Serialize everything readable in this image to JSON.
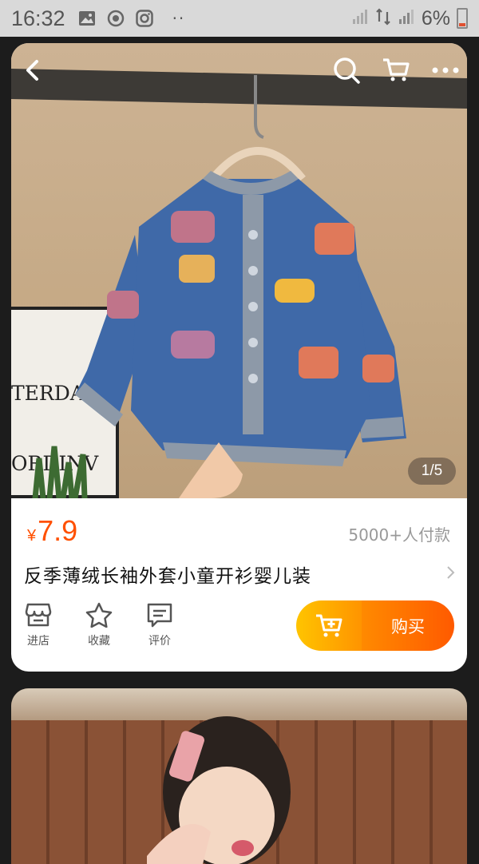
{
  "status_bar": {
    "time": "16:32",
    "icons_left": [
      "gallery-icon",
      "sync-icon",
      "instagram-icon"
    ],
    "dots": "··",
    "battery_text": "6%"
  },
  "product": {
    "pager": "1/5",
    "currency": "¥",
    "price": "7.9",
    "sold": "5000+人付款",
    "title": "反季薄绒长袖外套小童开衫婴儿装",
    "poster_lines": [
      "TERDAY",
      "ORDINV"
    ]
  },
  "actions": [
    {
      "icon": "store-icon",
      "label": "进店"
    },
    {
      "icon": "star-icon",
      "label": "收藏"
    },
    {
      "icon": "review-icon",
      "label": "评价"
    }
  ],
  "buy_label": "购买",
  "colors": {
    "accent": "#ff5000",
    "cart_gradient": [
      "#ffc400",
      "#ff9400"
    ],
    "buy_gradient": [
      "#ff8a00",
      "#ff5a00"
    ]
  }
}
